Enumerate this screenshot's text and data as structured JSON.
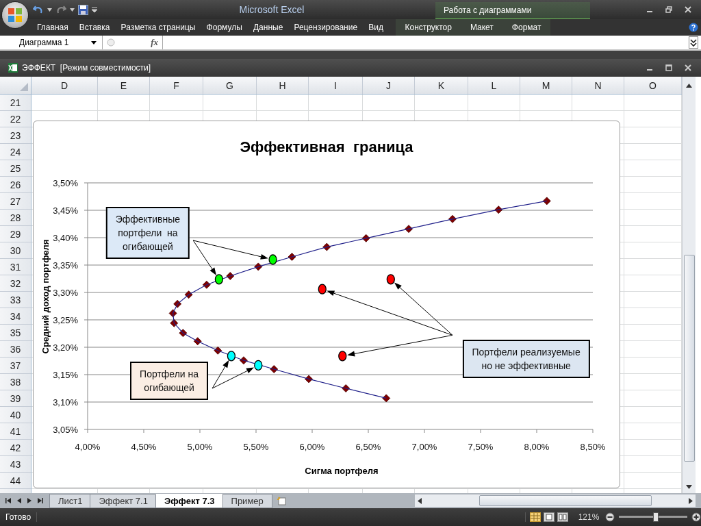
{
  "app": {
    "title": "Microsoft Excel",
    "context_group": "Работа с диаграммами"
  },
  "ribbon_tabs": [
    {
      "label": "Главная",
      "kind": "standard"
    },
    {
      "label": "Вставка",
      "kind": "standard"
    },
    {
      "label": "Разметка страницы",
      "kind": "standard"
    },
    {
      "label": "Формулы",
      "kind": "standard"
    },
    {
      "label": "Данные",
      "kind": "standard"
    },
    {
      "label": "Рецензирование",
      "kind": "standard"
    },
    {
      "label": "Вид",
      "kind": "standard"
    },
    {
      "label": "Конструктор",
      "kind": "contextual"
    },
    {
      "label": "Макет",
      "kind": "contextual"
    },
    {
      "label": "Формат",
      "kind": "contextual"
    }
  ],
  "formula_bar": {
    "name_box": "Диаграмма 1",
    "function_label": "fx"
  },
  "workbook": {
    "title": "ЭФФЕКТ  [Режим совместимости]"
  },
  "columns": [
    "D",
    "E",
    "F",
    "G",
    "H",
    "I",
    "J",
    "K",
    "L",
    "M",
    "N",
    "O"
  ],
  "rows": [
    "21",
    "22",
    "23",
    "24",
    "25",
    "26",
    "27",
    "28",
    "29",
    "30",
    "31",
    "32",
    "33",
    "34",
    "35",
    "36",
    "37",
    "38",
    "39",
    "40",
    "41",
    "42",
    "43",
    "44"
  ],
  "chart": {
    "chart_data": {
      "type": "scatter",
      "title": "Эффективная  граница",
      "xlabel": "Сигма портфеля",
      "ylabel": "Средний доход портфеля",
      "xlim": [
        4,
        8.5
      ],
      "ylim": [
        3.05,
        3.5
      ],
      "xticks": [
        {
          "value": 4,
          "label": "4,00%"
        },
        {
          "value": 4.5,
          "label": "4,50%"
        },
        {
          "value": 5,
          "label": "5,00%"
        },
        {
          "value": 5.5,
          "label": "5,50%"
        },
        {
          "value": 6,
          "label": "6,00%"
        },
        {
          "value": 6.5,
          "label": "6,50%"
        },
        {
          "value": 7,
          "label": "7,00%"
        },
        {
          "value": 7.5,
          "label": "7,50%"
        },
        {
          "value": 8,
          "label": "8,00%"
        },
        {
          "value": 8.5,
          "label": "8,50%"
        }
      ],
      "yticks": [
        {
          "value": 3.05,
          "label": "3,05%"
        },
        {
          "value": 3.1,
          "label": "3,10%"
        },
        {
          "value": 3.15,
          "label": "3,15%"
        },
        {
          "value": 3.2,
          "label": "3,20%"
        },
        {
          "value": 3.25,
          "label": "3,25%"
        },
        {
          "value": 3.3,
          "label": "3,30%"
        },
        {
          "value": 3.35,
          "label": "3,35%"
        },
        {
          "value": 3.4,
          "label": "3,40%"
        },
        {
          "value": 3.45,
          "label": "3,45%"
        },
        {
          "value": 3.5,
          "label": "3,50%"
        }
      ],
      "series": [
        {
          "type": "line",
          "color": "#7f0000",
          "marker": "diamond",
          "x": [
            6.66,
            6.3,
            5.97,
            5.66,
            5.39,
            5.16,
            4.98,
            4.85,
            4.77,
            4.76,
            4.8,
            4.9,
            5.06,
            5.27,
            5.52,
            5.82,
            6.13,
            6.48,
            6.86,
            7.25,
            7.66,
            8.09
          ],
          "values": [
            3.107,
            3.125,
            3.142,
            3.16,
            3.176,
            3.194,
            3.211,
            3.226,
            3.244,
            3.262,
            3.279,
            3.296,
            3.314,
            3.33,
            3.347,
            3.365,
            3.383,
            3.399,
            3.416,
            3.434,
            3.451,
            3.467
          ]
        },
        {
          "type": "scatter",
          "color": "#00ff00",
          "marker": "circle",
          "x": [
            5.17,
            5.65
          ],
          "values": [
            3.324,
            3.36
          ]
        },
        {
          "type": "scatter",
          "color": "#00ffff",
          "marker": "circle",
          "x": [
            5.28,
            5.52
          ],
          "values": [
            3.184,
            3.167
          ]
        },
        {
          "type": "scatter",
          "color": "#ff0000",
          "marker": "circle",
          "x": [
            6.09,
            6.7,
            6.27
          ],
          "values": [
            3.306,
            3.324,
            3.184
          ]
        }
      ],
      "grid": true
    },
    "callouts": [
      {
        "text": "Эффективные\nпортфели  на\nогибающей",
        "color": "#dce9f7"
      },
      {
        "text": "Портфели на\nогибающей",
        "color": "#fbeee4"
      },
      {
        "text": "Портфели реализуемые\nно не эффективные",
        "color": "#dce6f1"
      }
    ]
  },
  "sheet_tabs": [
    {
      "label": "Лист1",
      "selected": false
    },
    {
      "label": "Эффект 7.1",
      "selected": false
    },
    {
      "label": "Эффект 7.3",
      "selected": true
    },
    {
      "label": "Пример",
      "selected": false
    }
  ],
  "status_bar": {
    "status": "Готово",
    "zoom": "121%",
    "zoom_slider": {
      "level": 0.54
    }
  }
}
